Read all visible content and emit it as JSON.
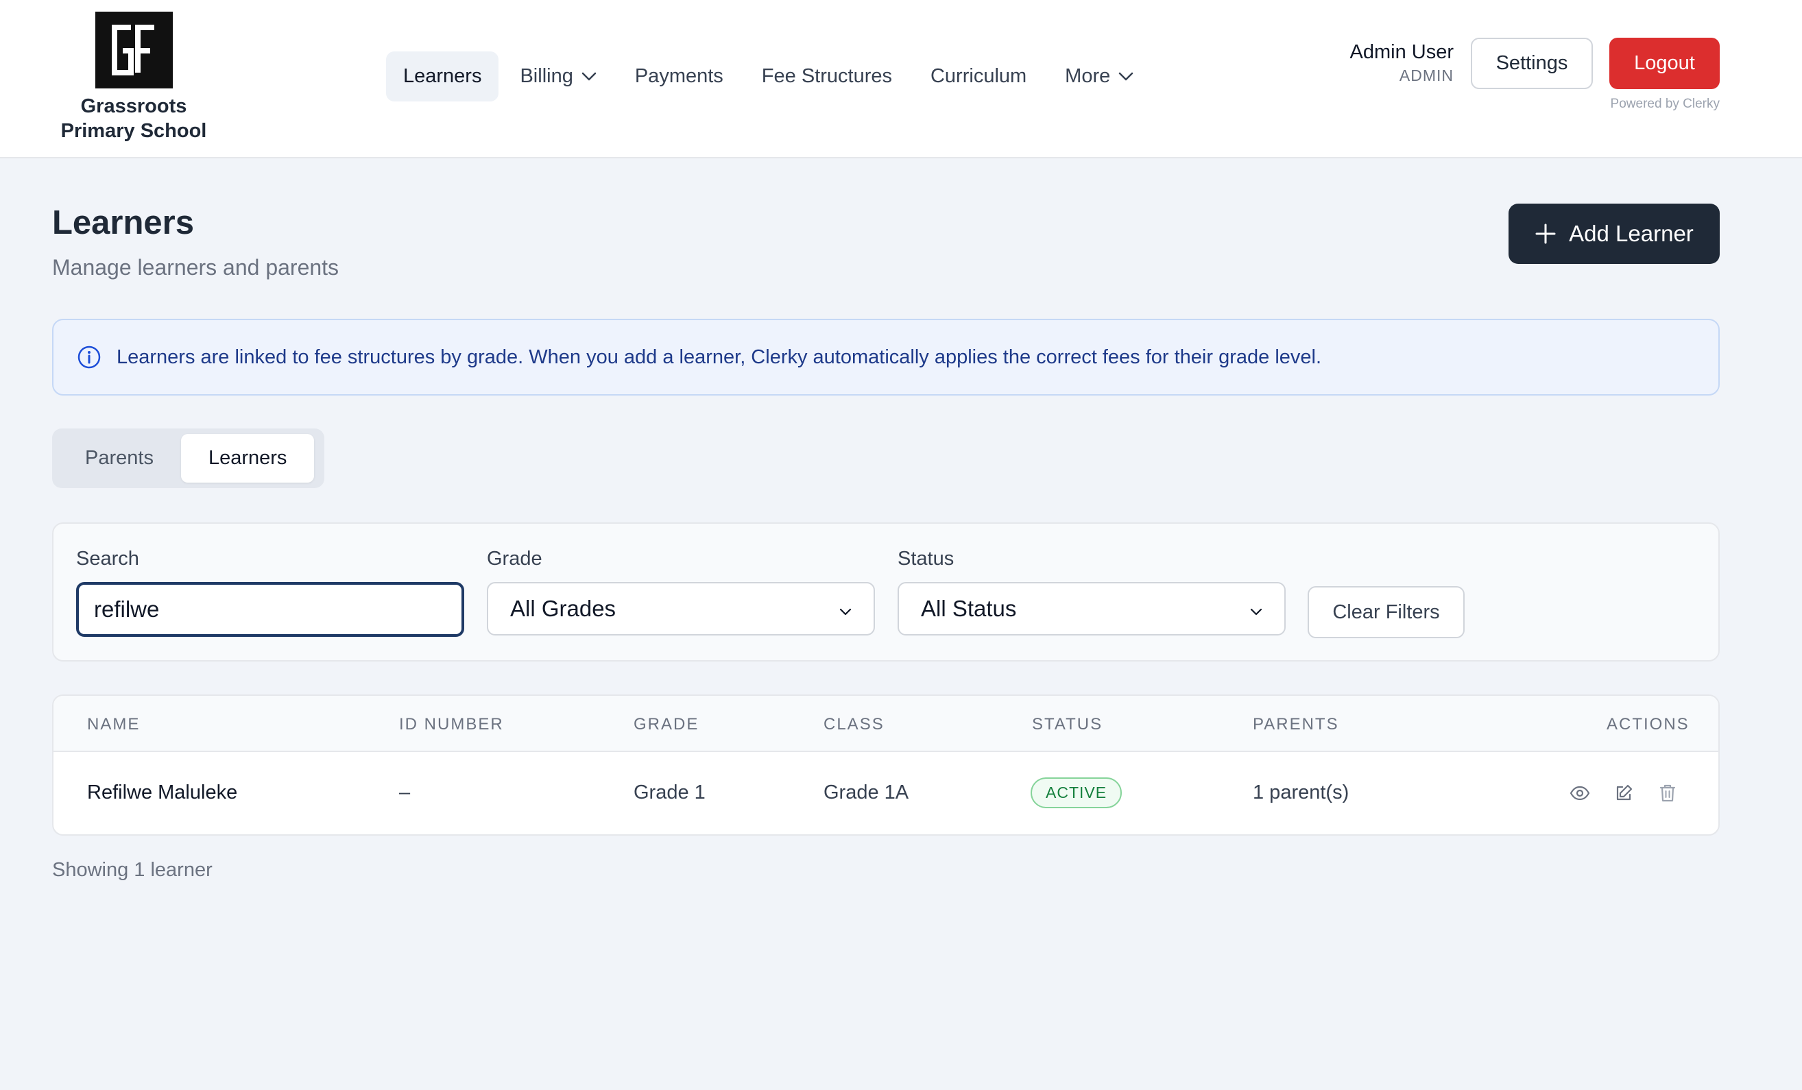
{
  "brand": {
    "logo_text": "GF",
    "school_name_line1": "Grassroots",
    "school_name_line2": "Primary School"
  },
  "nav": {
    "items": [
      {
        "label": "Learners",
        "active": true,
        "has_dropdown": false
      },
      {
        "label": "Billing",
        "active": false,
        "has_dropdown": true
      },
      {
        "label": "Payments",
        "active": false,
        "has_dropdown": false
      },
      {
        "label": "Fee Structures",
        "active": false,
        "has_dropdown": false
      },
      {
        "label": "Curriculum",
        "active": false,
        "has_dropdown": false
      },
      {
        "label": "More",
        "active": false,
        "has_dropdown": true
      }
    ]
  },
  "user": {
    "name": "Admin User",
    "role": "ADMIN",
    "settings_label": "Settings",
    "logout_label": "Logout",
    "powered_by": "Powered by Clerky"
  },
  "page": {
    "title": "Learners",
    "subtitle": "Manage learners and parents",
    "add_button_label": "Add Learner"
  },
  "info_banner": {
    "icon": "info-icon",
    "text": "Learners are linked to fee structures by grade. When you add a learner, Clerky automatically applies the correct fees for their grade level."
  },
  "tabs": [
    {
      "label": "Parents",
      "active": false
    },
    {
      "label": "Learners",
      "active": true
    }
  ],
  "filters": {
    "search_label": "Search",
    "search_value": "refilwe",
    "grade_label": "Grade",
    "grade_value": "All Grades",
    "status_label": "Status",
    "status_value": "All Status",
    "clear_label": "Clear Filters"
  },
  "table": {
    "columns": [
      "NAME",
      "ID NUMBER",
      "GRADE",
      "CLASS",
      "STATUS",
      "PARENTS",
      "ACTIONS"
    ],
    "rows": [
      {
        "name": "Refilwe Maluleke",
        "id_number": "–",
        "grade": "Grade 1",
        "class": "Grade 1A",
        "status": "ACTIVE",
        "parents": "1 parent(s)",
        "actions": [
          "eye-icon",
          "edit-icon",
          "trash-icon"
        ]
      }
    ]
  },
  "footer": {
    "showing_text": "Showing 1 learner"
  },
  "colors": {
    "primary_dark": "#1f2937",
    "logout_red": "#dc2e2e",
    "info_bg": "#eef3fd",
    "info_text": "#1e3a8a",
    "active_green": "#15803d",
    "page_bg": "#f1f4f9"
  }
}
